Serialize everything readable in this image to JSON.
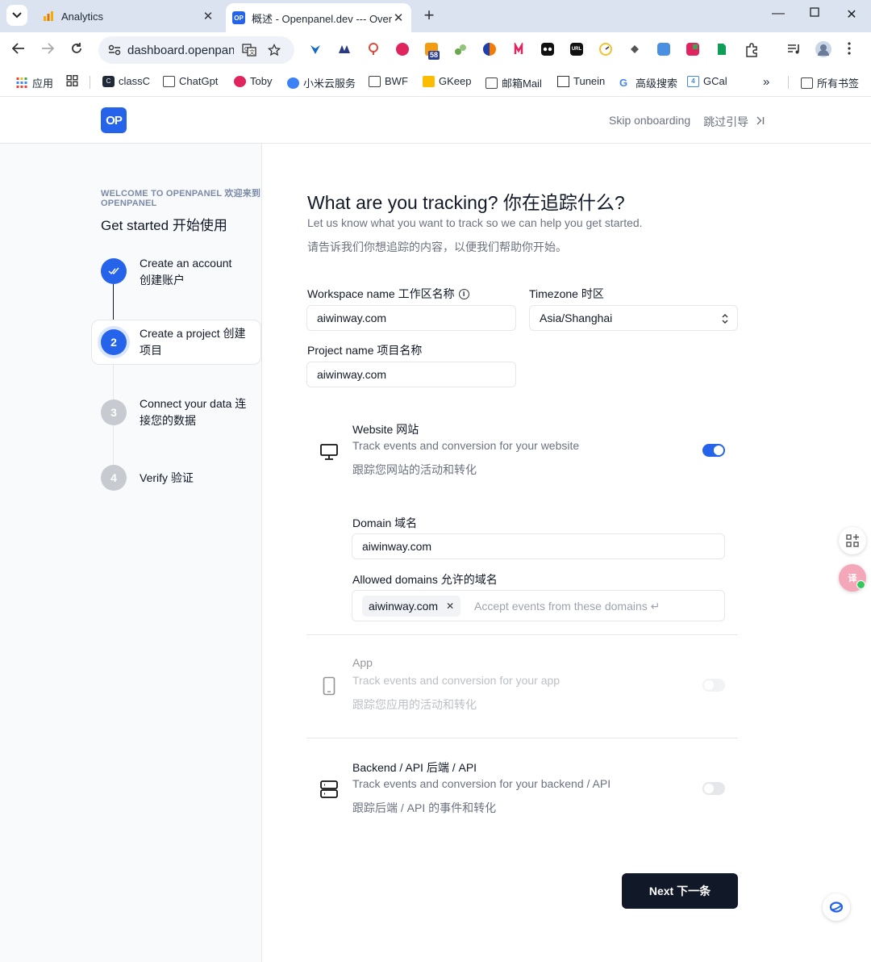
{
  "browser": {
    "tabs": [
      {
        "title": "Analytics",
        "active": false
      },
      {
        "title": "概述 - Openpanel.dev --- Overview",
        "active": true
      }
    ],
    "url": "dashboard.openpanel.dev",
    "bookmarks": [
      "应用",
      "classC",
      "ChatGpt",
      "Toby",
      "小米云服务",
      "BWF",
      "GKeep",
      "邮箱Mail",
      "Tunein",
      "高级搜索",
      "GCal",
      "所有书签"
    ],
    "extension_badge": "58",
    "overflow": "»"
  },
  "header": {
    "logo_text": "OP",
    "skip_label": "Skip onboarding",
    "skip_label_zh": "跳过引导"
  },
  "sidebar": {
    "welcome": "WELCOME TO OPENPANEL 欢迎来到 OPENPANEL",
    "title": "Get started  开始使用",
    "steps": [
      {
        "number": "✓",
        "label": "Create an account  创建账户",
        "state": "done"
      },
      {
        "number": "2",
        "label": "Create a project  创建项目",
        "state": "active"
      },
      {
        "number": "3",
        "label": "Connect your data  连接您的数据",
        "state": "todo"
      },
      {
        "number": "4",
        "label": "Verify  验证",
        "state": "todo"
      }
    ]
  },
  "main": {
    "title": "What are you tracking?  你在追踪什么?",
    "subtitle": "Let us know what you want to track so we can help you get started.",
    "subtitle_zh": "请告诉我们你想追踪的内容，以便我们帮助你开始。",
    "workspace_label": "Workspace name  工作区名称",
    "workspace_value": "aiwinway.com",
    "timezone_label": "Timezone  时区",
    "timezone_value": "Asia/Shanghai",
    "project_label": "Project name  项目名称",
    "project_value": "aiwinway.com",
    "types": {
      "website": {
        "title": "Website  网站",
        "desc": "Track events and conversion for your website",
        "desc_zh": "跟踪您网站的活动和转化",
        "enabled": true
      },
      "app": {
        "title": "App",
        "desc": "Track events and conversion for your app",
        "desc_zh": "跟踪您应用的活动和转化",
        "enabled": false
      },
      "backend": {
        "title": "Backend / API  后端 / API",
        "desc": "Track events and conversion for your backend / API",
        "desc_zh": "跟踪后端 / API 的事件和转化",
        "enabled": false
      }
    },
    "domain_label": "Domain  域名",
    "domain_value": "aiwinway.com",
    "allowed_label": "Allowed domains  允许的域名",
    "allowed_tag": "aiwinway.com",
    "allowed_placeholder": "Accept events from these domains ↵",
    "next_label": "Next  下一条"
  },
  "colors": {
    "accent": "#2563eb",
    "button_dark": "#111827",
    "muted_text": "#6b7280"
  }
}
